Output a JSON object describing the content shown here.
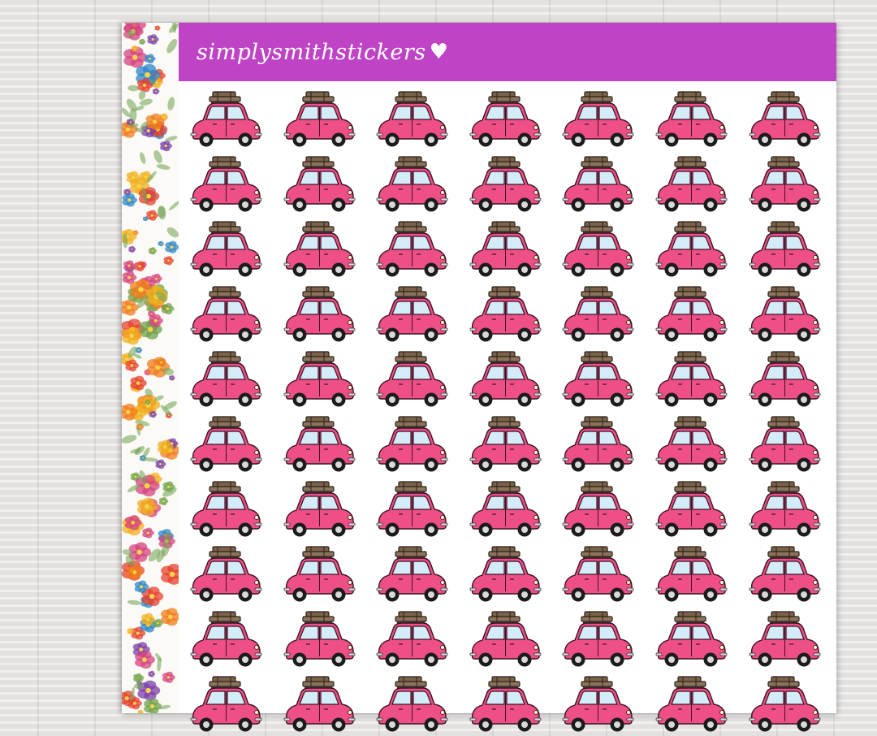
{
  "banner": {
    "brand_text": "simplysmithstickers",
    "heart_icon": "heart-icon",
    "color": "#bf44c5"
  },
  "sticker": {
    "icon": "pink-car-with-luggage-icon",
    "body_color": "#ee4f86",
    "window_color": "#d3ecf7",
    "luggage_color": "#7a624b",
    "rows": 10,
    "columns": 7
  },
  "floral_strip": {
    "icon": "watercolor-flower-icon",
    "colors": [
      "#f2b01e",
      "#e7412d",
      "#7a3fa9",
      "#2d86c8",
      "#f07c1c",
      "#6fa24a",
      "#d6437f"
    ]
  }
}
